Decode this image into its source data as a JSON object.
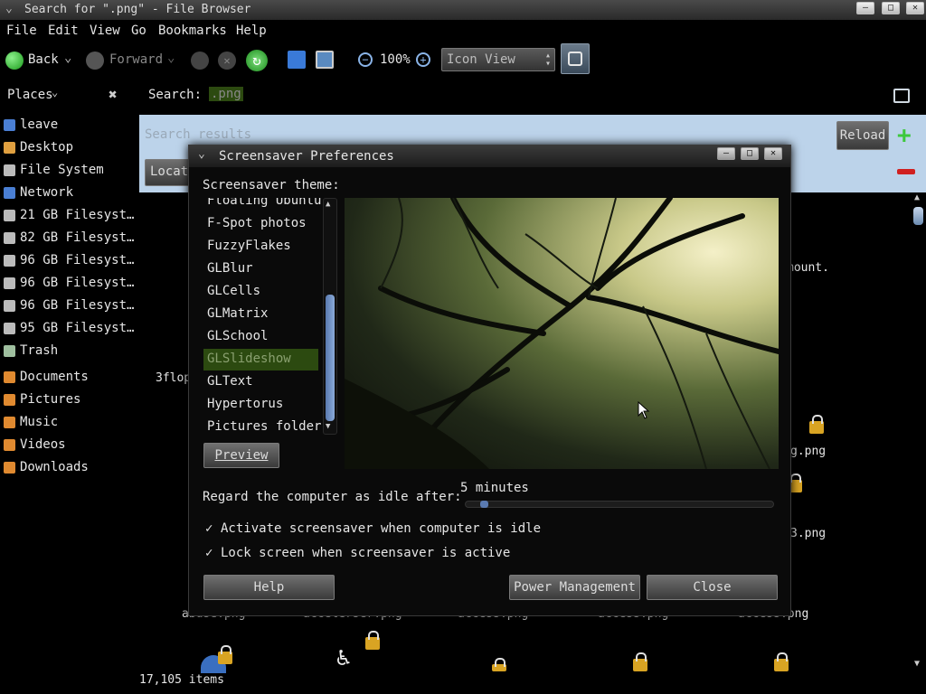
{
  "window": {
    "title": "Search for \".png\" - File Browser"
  },
  "menu": [
    "File",
    "Edit",
    "View",
    "Go",
    "Bookmarks",
    "Help"
  ],
  "toolbar": {
    "back": "Back",
    "forward": "Forward",
    "zoom": "100%",
    "view_mode": "Icon View"
  },
  "sidebar": {
    "header": "Places",
    "items": [
      {
        "label": "leave",
        "icon": "home-icon",
        "color": "#4a7fd4"
      },
      {
        "label": "Desktop",
        "icon": "desktop-icon",
        "color": "#e0a040"
      },
      {
        "label": "File System",
        "icon": "drive-icon",
        "color": "#bbbbbb"
      },
      {
        "label": "Network",
        "icon": "network-icon",
        "color": "#4a7fd4"
      },
      {
        "label": "21 GB Filesyst…",
        "icon": "drive-icon",
        "color": "#bbbbbb"
      },
      {
        "label": "82 GB Filesyst…",
        "icon": "drive-icon",
        "color": "#bbbbbb"
      },
      {
        "label": "96 GB Filesyst…",
        "icon": "drive-icon",
        "color": "#bbbbbb"
      },
      {
        "label": "96 GB Filesyst…",
        "icon": "drive-icon",
        "color": "#bbbbbb"
      },
      {
        "label": "96 GB Filesyst…",
        "icon": "drive-icon",
        "color": "#bbbbbb"
      },
      {
        "label": "95 GB Filesyst…",
        "icon": "drive-icon",
        "color": "#bbbbbb"
      },
      {
        "label": "Trash",
        "icon": "trash-icon",
        "color": "#9fbf9f"
      },
      {
        "label": "Documents",
        "icon": "folder-icon",
        "color": "#e08a30"
      },
      {
        "label": "Pictures",
        "icon": "folder-icon",
        "color": "#e08a30"
      },
      {
        "label": "Music",
        "icon": "folder-icon",
        "color": "#e08a30"
      },
      {
        "label": "Videos",
        "icon": "folder-icon",
        "color": "#e08a30"
      },
      {
        "label": "Downloads",
        "icon": "folder-icon",
        "color": "#e08a30"
      }
    ]
  },
  "search": {
    "label": "Search:",
    "query": ".png",
    "placeholder": "Search results",
    "reload": "Reload",
    "location": "Locat"
  },
  "dialog": {
    "title": "Screensaver Preferences",
    "theme_label": "Screensaver theme:",
    "themes": [
      "Floating Ubuntu",
      "F-Spot photos",
      "FuzzyFlakes",
      "GLBlur",
      "GLCells",
      "GLMatrix",
      "GLSchool",
      "GLSlideshow",
      "GLText",
      "Hypertorus",
      "Pictures folder"
    ],
    "selected_theme": "GLSlideshow",
    "preview_button": "Preview",
    "idle_label": "Regard the computer as idle after:",
    "idle_value": "5 minutes",
    "idle_fraction": 0.03,
    "activate_label": "Activate screensaver when computer is idle",
    "lock_label": "Lock screen when screensaver is active",
    "help_button": "Help",
    "power_button": "Power Management",
    "close_button": "Close"
  },
  "files": {
    "names": [
      "abuse.png",
      "accelerser.png",
      "access.png",
      "access.png",
      "access.png"
    ],
    "partial": [
      "3flop",
      "mount.",
      "g.png",
      "3.png"
    ],
    "status": "17,105 items"
  },
  "colors": {
    "selection": "#2c4a10",
    "blue_bar": "#bcd3ea",
    "accent_green": "#3cc83c"
  }
}
